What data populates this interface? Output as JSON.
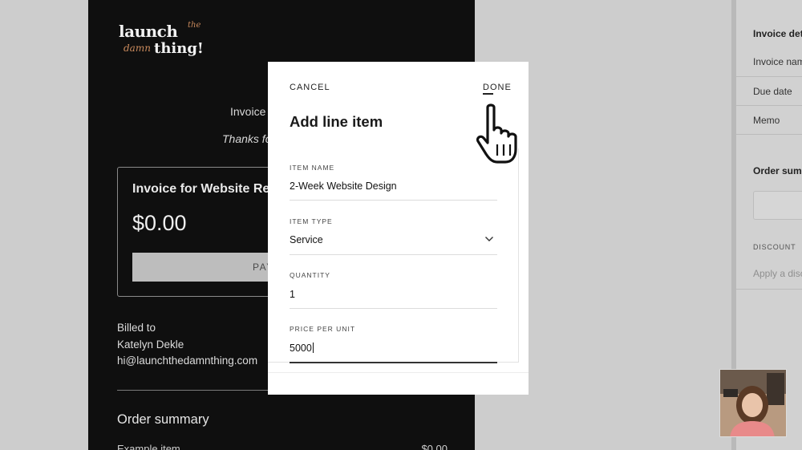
{
  "invoice_preview": {
    "logo": {
      "word_main": "launch",
      "word_small": "the",
      "word_script": "damn",
      "word_end": "thing!"
    },
    "line1": "Invoice",
    "line2": "Thanks fo",
    "card_title": "Invoice for Website Re",
    "card_amount": "$0.00",
    "pay_label": "PAY",
    "billed_to_label": "Billed to",
    "billed_name": "Katelyn Dekle",
    "billed_email": "hi@launchthedamnthing.com",
    "order_summary_title": "Order summary",
    "example_item_label": "Example item",
    "example_item_price": "$0.00"
  },
  "right_panel": {
    "invoice_details_heading": "Invoice det",
    "invoice_name_label": "Invoice nam",
    "due_date_label": "Due date",
    "memo_label": "Memo",
    "order_summary_heading": "Order summ",
    "discount_label": "DISCOUNT",
    "discount_placeholder": "Apply a disc"
  },
  "modal": {
    "cancel_label": "CANCEL",
    "done_label": "DONE",
    "title": "Add line item",
    "fields": {
      "item_name": {
        "label": "ITEM NAME",
        "value": "2-Week Website Design"
      },
      "item_type": {
        "label": "ITEM TYPE",
        "value": "Service"
      },
      "quantity": {
        "label": "QUANTITY",
        "value": "1"
      },
      "price_per_unit": {
        "label": "PRICE PER UNIT",
        "value": "5000"
      }
    }
  },
  "icons": {
    "cursor": "pointing-hand-cursor-icon",
    "select": "chevron-down-icon"
  },
  "colors": {
    "invoice_bg": "#0f0f0f",
    "modal_bg": "#ffffff",
    "backdrop": "#cdcdcd",
    "logo_accent": "#c8895c"
  }
}
